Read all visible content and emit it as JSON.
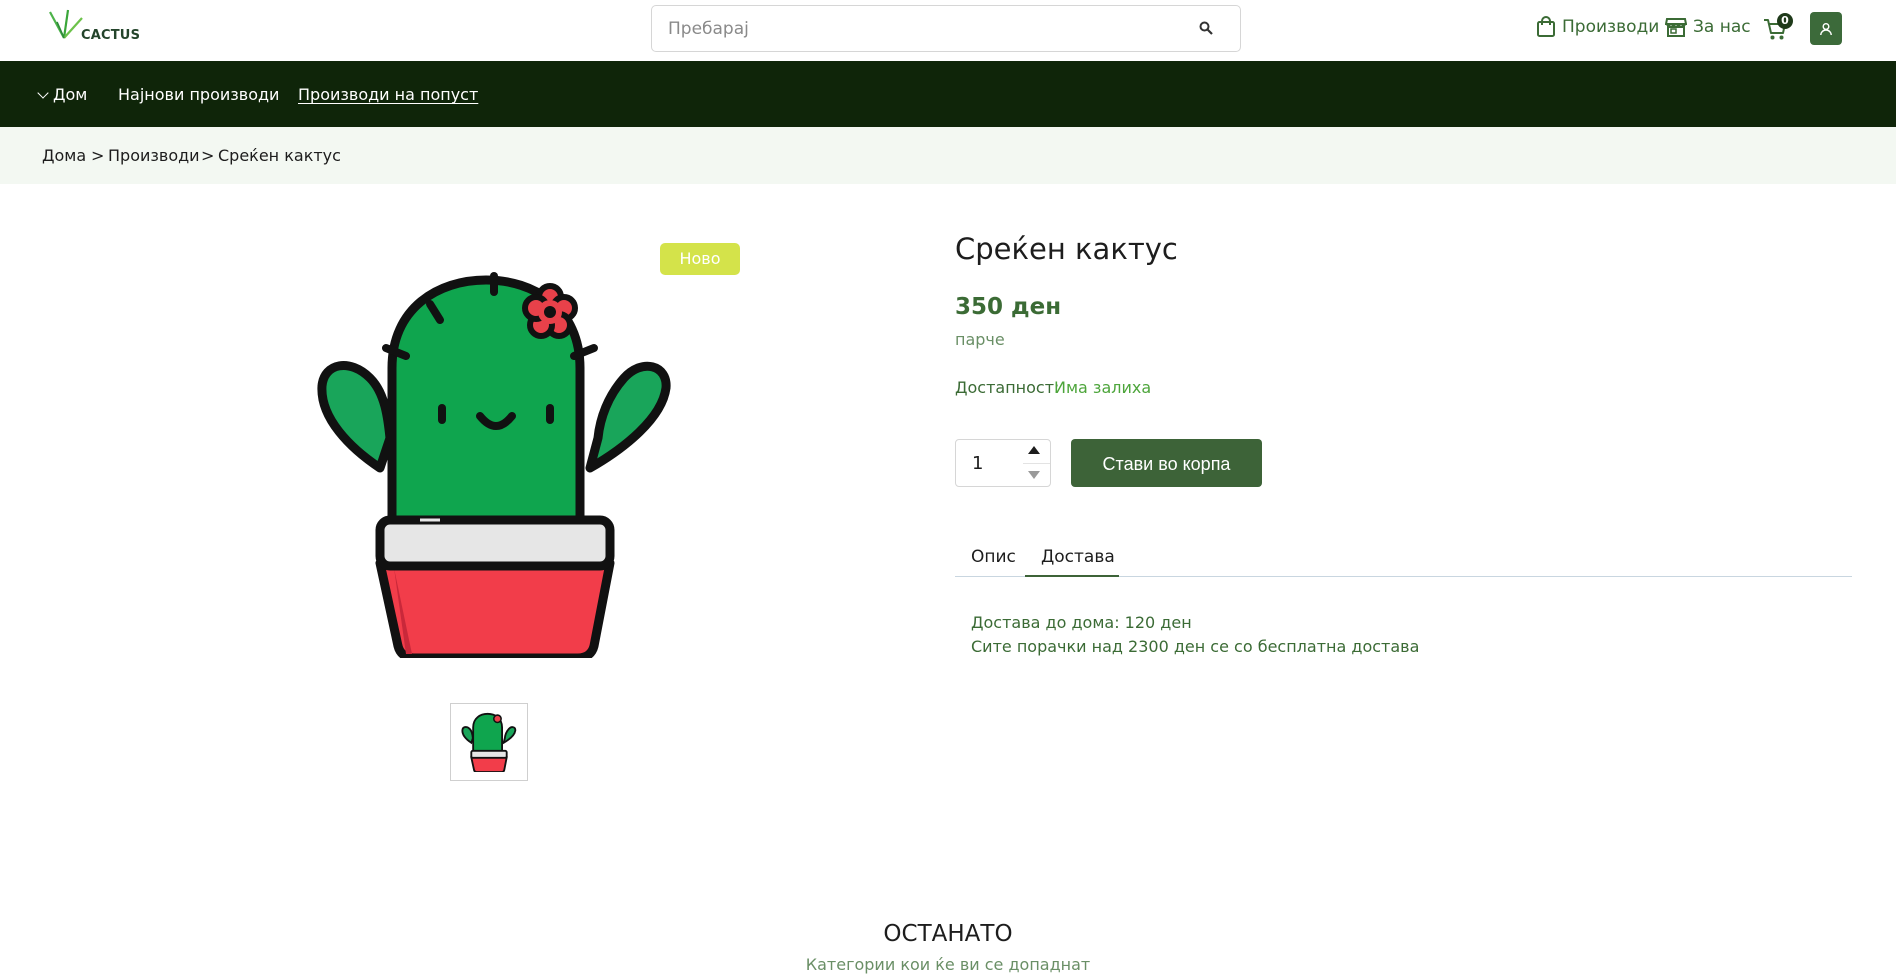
{
  "header": {
    "logo_text": "CACTUS",
    "search_placeholder": "Пребарај",
    "products_link": "Производи",
    "about_link": "За нас",
    "cart_count": "0"
  },
  "nav": {
    "items": [
      {
        "label": "Дом"
      },
      {
        "label": "Најнови производи"
      },
      {
        "label": "Производи на попуст"
      }
    ]
  },
  "breadcrumb": {
    "items": [
      "Дома",
      "Производи",
      "Среќен кактус"
    ],
    "separator": ">"
  },
  "product": {
    "badge": "Ново",
    "title": "Среќен кактус",
    "price": "350 ден",
    "unit": "парче",
    "availability_label": "Достапност:",
    "availability_value": "Има залиха",
    "quantity": "1",
    "add_to_cart": "Стави во корпа",
    "tabs": [
      {
        "label": "Опис"
      },
      {
        "label": "Достава",
        "active": true
      }
    ],
    "delivery_lines": [
      "Достава до дома: 120 ден",
      "Сите порачки над 2300 ден се со бесплатна достава"
    ]
  },
  "others": {
    "title": "ОСТАНАТО",
    "subtitle": "Категории кои ќе ви се допаднат"
  },
  "colors": {
    "nav_bg": "#0f2509",
    "accent": "#3d6338",
    "badge": "#d4e34a",
    "breadcrumb_bg": "#f3f8f2"
  },
  "icons": [
    "search-icon",
    "shopping-bag-icon",
    "store-icon",
    "cart-icon",
    "user-icon",
    "chevron-down-icon"
  ]
}
